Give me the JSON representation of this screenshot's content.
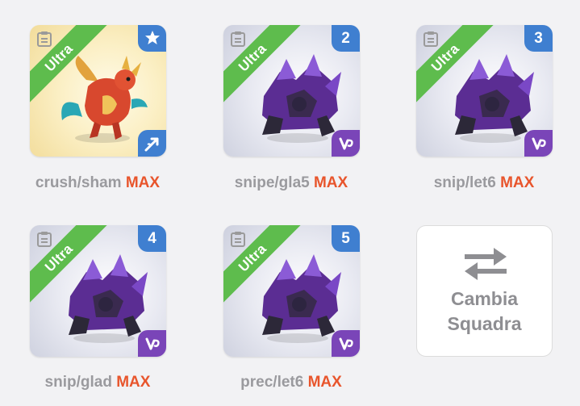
{
  "tier_label": "Ultra",
  "max_label": "MAX",
  "cards": [
    {
      "name": "crush/sham",
      "badge": "star",
      "type": "wind"
    },
    {
      "name": "snipe/gla5",
      "badge": "2",
      "type": "dark"
    },
    {
      "name": "snip/let6",
      "badge": "3",
      "type": "dark"
    },
    {
      "name": "snip/glad",
      "badge": "4",
      "type": "dark"
    },
    {
      "name": "prec/let6",
      "badge": "5",
      "type": "dark"
    }
  ],
  "icons": {
    "doc": "document-icon",
    "star": "star-icon",
    "wind": "wind-element-icon",
    "dark": "dark-element-icon",
    "swap": "swap-arrows-icon"
  },
  "swap_button": {
    "line1": "Cambia",
    "line2": "Squadra"
  },
  "colors": {
    "ribbon": "#5ebc4d",
    "badge_blue": "#3f7fd0",
    "badge_purple": "#7a45b8",
    "max": "#e8552c",
    "label_gray": "#9a9a9e"
  }
}
